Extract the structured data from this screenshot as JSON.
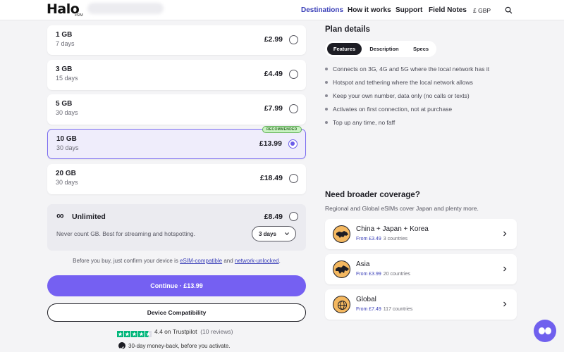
{
  "header": {
    "logo": "Halo",
    "logo_sub": "eSIM",
    "nav": [
      "Destinations",
      "How it works",
      "Support",
      "Field Notes",
      "£ GBP"
    ],
    "active_nav": "Destinations"
  },
  "plans": [
    {
      "data": "1 GB",
      "days": "7 days",
      "price": "£2.99",
      "selected": false
    },
    {
      "data": "3 GB",
      "days": "15 days",
      "price": "£4.49",
      "selected": false
    },
    {
      "data": "5 GB",
      "days": "30 days",
      "price": "£7.99",
      "selected": false
    },
    {
      "data": "10 GB",
      "days": "30 days",
      "price": "£13.99",
      "selected": true
    },
    {
      "data": "20 GB",
      "days": "30 days",
      "price": "£18.49",
      "selected": false
    }
  ],
  "recommended_badge": "RECOMMENDED",
  "unlimited": {
    "icon": "infinity-icon",
    "title": "Unlimited",
    "price": "£8.49",
    "description": "Never count GB. Best for streaming and hotspotting.",
    "days_selected": "3 days"
  },
  "note": {
    "prefix": "Before you buy, just confirm your device is ",
    "link1": "eSIM-compatible",
    "middle": " and ",
    "link2": "network-unlocked",
    "suffix": "."
  },
  "buttons": {
    "continue": "Continue · £13.99",
    "compatibility": "Device Compatibility"
  },
  "trustpilot": {
    "rating_text": "4.4 on Trustpilot",
    "reviews": "(10 reviews)",
    "stars": 4.5
  },
  "money_back": "30-day money-back, before you activate.",
  "plan_details": {
    "title": "Plan details",
    "tabs": [
      "Features",
      "Description",
      "Specs"
    ],
    "active_tab": "Features",
    "features": [
      "Connects on 3G, 4G and 5G where the local network has it",
      "Hotspot and tethering where the local network allows",
      "Keep your own number, data only (no calls or texts)",
      "Activates on first connection, not at purchase",
      "Top up any time, no faff"
    ]
  },
  "broader": {
    "title": "Need broader coverage?",
    "subtitle": "Regional and Global eSIMs cover Japan and plenty more.",
    "regions": [
      {
        "name": "China + Japan + Korea",
        "from": "From £3.49",
        "count": "3 countries",
        "icon": "asia-map-icon"
      },
      {
        "name": "Asia",
        "from": "From £3.99",
        "count": "20 countries",
        "icon": "asia-map-icon"
      },
      {
        "name": "Global",
        "from": "From £7.49",
        "count": "117 countries",
        "icon": "globe-icon"
      }
    ]
  },
  "colors": {
    "accent": "#7560f2",
    "link": "#3a3fb8",
    "trustpilot": "#00b67a"
  }
}
